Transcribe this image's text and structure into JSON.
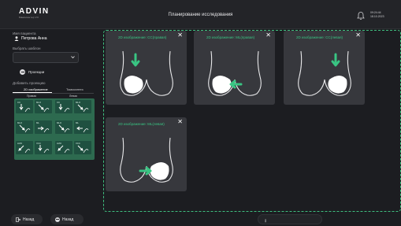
{
  "header": {
    "logo": "ADVIN",
    "logo_sub": "Мамолонтер   VII",
    "title": "Планирование исследования",
    "time": "09:24:44",
    "date": "18.10.2023"
  },
  "sidebar": {
    "patient_label": "Имя пациента",
    "patient_name": "Петрова Анна",
    "template_label": "Выбрать шаблон",
    "projections_button": "Проекции",
    "add_projection_label": "Добавить проекцию",
    "tabs": [
      "2D изображение",
      "Томосинтез"
    ],
    "col_right": "Правая",
    "col_left": "Левая",
    "thumbs": [
      "CC",
      "MLO",
      "CC",
      "MLO",
      "MLO",
      "ML",
      "MLO",
      "ML",
      "LMO",
      "XCC",
      "LMO",
      "XCC"
    ]
  },
  "cards": [
    {
      "title": "2D изображение: CC(правая)",
      "arrow": "down"
    },
    {
      "title": "2D изображение: ML(правая)",
      "arrow": "left"
    },
    {
      "title": "2D изображение: CC(левая)",
      "arrow": "down"
    },
    {
      "title": "2D изображение: ML(левая)",
      "arrow": "right"
    }
  ],
  "footer": {
    "back1": "Назад",
    "back2": "Назад"
  },
  "colors": {
    "accent": "#39c583",
    "background": "#1c1d21",
    "card": "#37383d"
  }
}
